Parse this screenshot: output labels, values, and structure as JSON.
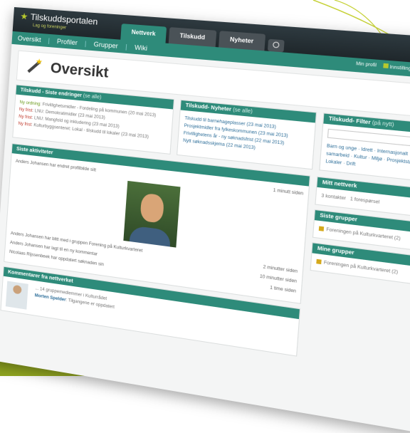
{
  "app": {
    "name": "Tilskuddsportalen",
    "subtitle": "Lag og foreninger"
  },
  "tabs": [
    "Nettverk",
    "Tilskudd",
    "Nyheter"
  ],
  "nav": [
    "Oversikt",
    "Profiler",
    "Grupper",
    "Wiki"
  ],
  "user": {
    "profile": "Min profil",
    "settings": "Innstillinger"
  },
  "page": {
    "title": "Oversikt"
  },
  "updates": {
    "heading": "Tilskudd - Siste endringer",
    "more": "(se alle)",
    "items": [
      {
        "status": "Ny ordning",
        "text": ": Frivillighetsmidler - Fordeling på kommunen (20 mai 2013)"
      },
      {
        "status": "Ny frist",
        "text": ": LNU: Demokratimidler (23 mai 2013)"
      },
      {
        "status": "Ny frist",
        "text": ": LNU: Mangfold og inkludering (23 mai 2013)"
      },
      {
        "status": "Ny frist",
        "text": ": Kulturbyggsenteret: Lokal - tilskudd til lokaler (23 mai 2013)"
      }
    ]
  },
  "news": {
    "heading": "Tilskudd- Nyheter",
    "more": "(se alle)",
    "items": [
      "Tilskudd til barnehageplasser (23 mai 2013)",
      "Prosjektmidler fra fylkeskommunen (23 mai 2013)",
      "Frivillighetens år - ny søknadsfrist (22 mai 2013)",
      "Nytt søknadsskjema (22 mai 2013)"
    ]
  },
  "filters": {
    "heading": "Tilskudd- Filter",
    "more": "(på nytt)",
    "tags": "Barn og unge · Idrett · Internasjonalt samarbeid · Kultur · Miljø · Prosjektstøtte · Lokaler · Drift"
  },
  "activity": {
    "heading": "Siste aktiviteter",
    "items": [
      {
        "text": "Anders Johansen har endret profilbilde sitt",
        "time": "1 minutt siden"
      },
      {
        "text": "Anders Johansen har blitt med i gruppen Forening på Kulturkvarteret",
        "time": "2 minutter siden"
      },
      {
        "text": "Anders Johansen har lagt til en ny kommentar",
        "time": "10 minutter siden"
      },
      {
        "text": "Nicolaas Rijssenbeek har oppdatert søknaden sin",
        "time": "1 time siden"
      }
    ]
  },
  "contacts": {
    "heading": "Mitt nettverk",
    "items": [
      "3 kontakter",
      "1 forespørsel"
    ]
  },
  "mygroups1": {
    "heading": "Siste grupper",
    "items": [
      "Foreningen på Kulturkvarteret (2)"
    ]
  },
  "mygroups2": {
    "heading": "Mine grupper",
    "items": [
      "Foreningen på Kulturkvarteret (2)"
    ]
  },
  "comments": {
    "heading": "Kommentarer fra nettverket",
    "items": [
      {
        "meta": "... 14 gruppemedlemmer i Kulturrådet",
        "author": "Morten Spelder",
        "text": ": Tilgangene er oppdatert"
      }
    ]
  }
}
